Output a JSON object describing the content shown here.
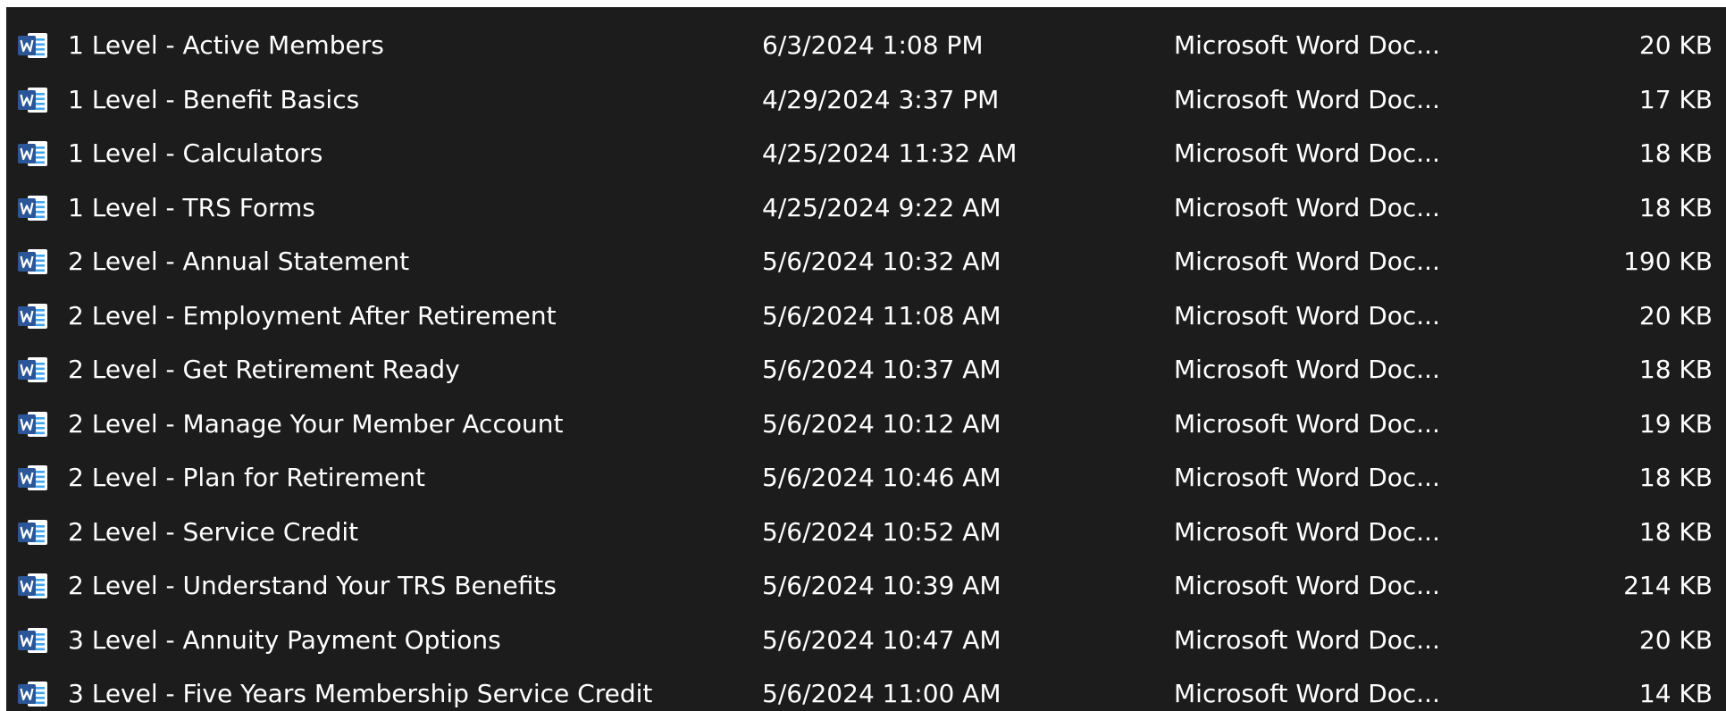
{
  "colors": {
    "list_background": "#1c1c1c",
    "text": "#ffffff",
    "word_blue": "#2b579a",
    "word_blue_light": "#41a5ee",
    "page_white": "#ffffff"
  },
  "icon": "word-document-icon",
  "files": [
    {
      "name": "1 Level - Active Members",
      "modified": "6/3/2024 1:08 PM",
      "type": "Microsoft Word Doc...",
      "size": "20 KB"
    },
    {
      "name": "1 Level - Benefit Basics",
      "modified": "4/29/2024 3:37 PM",
      "type": "Microsoft Word Doc...",
      "size": "17 KB"
    },
    {
      "name": "1 Level - Calculators",
      "modified": "4/25/2024 11:32 AM",
      "type": "Microsoft Word Doc...",
      "size": "18 KB"
    },
    {
      "name": "1 Level - TRS Forms",
      "modified": "4/25/2024 9:22 AM",
      "type": "Microsoft Word Doc...",
      "size": "18 KB"
    },
    {
      "name": "2 Level - Annual Statement",
      "modified": "5/6/2024 10:32 AM",
      "type": "Microsoft Word Doc...",
      "size": "190 KB"
    },
    {
      "name": "2 Level - Employment After Retirement",
      "modified": "5/6/2024 11:08 AM",
      "type": "Microsoft Word Doc...",
      "size": "20 KB"
    },
    {
      "name": "2 Level - Get Retirement Ready",
      "modified": "5/6/2024 10:37 AM",
      "type": "Microsoft Word Doc...",
      "size": "18 KB"
    },
    {
      "name": "2 Level - Manage Your Member Account",
      "modified": "5/6/2024 10:12 AM",
      "type": "Microsoft Word Doc...",
      "size": "19 KB"
    },
    {
      "name": "2 Level - Plan for Retirement",
      "modified": "5/6/2024 10:46 AM",
      "type": "Microsoft Word Doc...",
      "size": "18 KB"
    },
    {
      "name": "2 Level - Service Credit",
      "modified": "5/6/2024 10:52 AM",
      "type": "Microsoft Word Doc...",
      "size": "18 KB"
    },
    {
      "name": "2 Level - Understand Your TRS Benefits",
      "modified": "5/6/2024 10:39 AM",
      "type": "Microsoft Word Doc...",
      "size": "214 KB"
    },
    {
      "name": "3 Level - Annuity Payment Options",
      "modified": "5/6/2024 10:47 AM",
      "type": "Microsoft Word Doc...",
      "size": "20 KB"
    },
    {
      "name": "3 Level - Five Years Membership Service Credit",
      "modified": "5/6/2024 11:00 AM",
      "type": "Microsoft Word Doc...",
      "size": "14 KB"
    }
  ]
}
